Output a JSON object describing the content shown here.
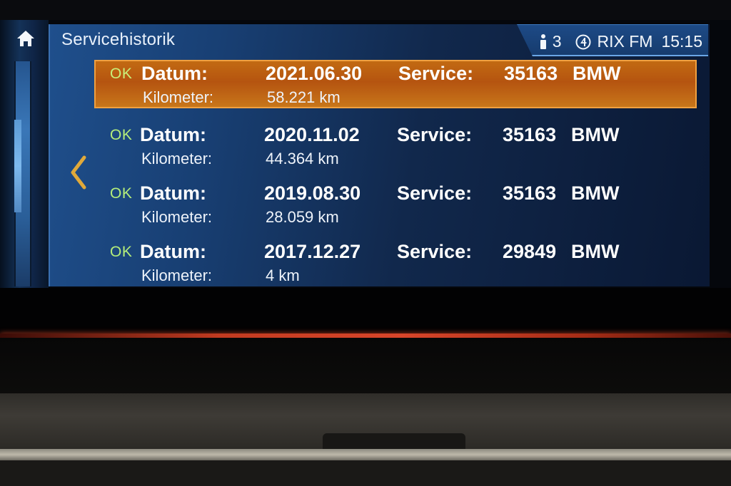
{
  "header": {
    "title": "Servicehistorik",
    "status": {
      "info_count": "3",
      "radio_station": "RIX FM",
      "clock": "15:15"
    }
  },
  "entries": [
    {
      "status": "OK",
      "date_label": "Datum:",
      "date": "2021.06.30",
      "service_label": "Service:",
      "service_code": "35163",
      "brand": "BMW",
      "km_label": "Kilometer:",
      "km": "58.221 km",
      "selected": true
    },
    {
      "status": "OK",
      "date_label": "Datum:",
      "date": "2020.11.02",
      "service_label": "Service:",
      "service_code": "35163",
      "brand": "BMW",
      "km_label": "Kilometer:",
      "km": "44.364 km",
      "selected": false
    },
    {
      "status": "OK",
      "date_label": "Datum:",
      "date": "2019.08.30",
      "service_label": "Service:",
      "service_code": "35163",
      "brand": "BMW",
      "km_label": "Kilometer:",
      "km": "28.059 km",
      "selected": false
    },
    {
      "status": "OK",
      "date_label": "Datum:",
      "date": "2017.12.27",
      "service_label": "Service:",
      "service_code": "29849",
      "brand": "BMW",
      "km_label": "Kilometer:",
      "km": "4 km",
      "selected": false
    }
  ],
  "icons": {
    "home": "home-icon",
    "back": "chevron-left-icon",
    "info": "info-icon",
    "radio": "radio-preset-icon"
  },
  "colors": {
    "accent_selected": "#c26a12",
    "ok_green": "#b5ee7a",
    "panel_blue": "#1f4f8c",
    "back_arrow": "#e0a93a"
  }
}
